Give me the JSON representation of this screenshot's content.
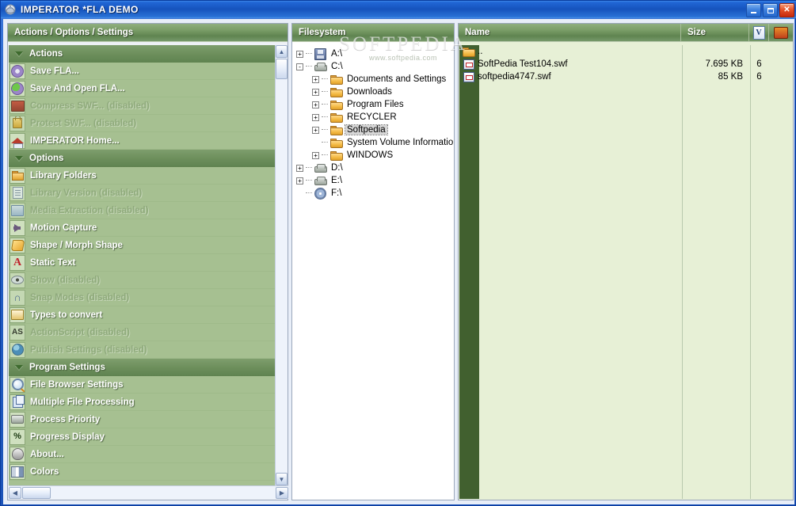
{
  "window": {
    "title": "IMPERATOR *FLA DEMO",
    "icon": "imperator-helmet-icon",
    "buttons": {
      "minimize": "minimize",
      "maximize": "maximize",
      "close": "close"
    }
  },
  "watermark": {
    "big": "SOFTPEDIA",
    "small": "www.softpedia.com"
  },
  "left_panel": {
    "header": "Actions / Options / Settings",
    "rows": [
      {
        "type": "group",
        "label": "Actions",
        "icon": "triangle-down-icon"
      },
      {
        "type": "item",
        "label": "Save FLA...",
        "icon": "gear-purple-icon",
        "disabled": false
      },
      {
        "type": "item",
        "label": "Save And Open FLA...",
        "icon": "gear-green-icon",
        "disabled": false
      },
      {
        "type": "item",
        "label": "Compress SWF... (disabled)",
        "icon": "monitor-red-icon",
        "disabled": true
      },
      {
        "type": "item",
        "label": "Protect SWF... (disabled)",
        "icon": "lock-icon",
        "disabled": true
      },
      {
        "type": "item",
        "label": "IMPERATOR Home...",
        "icon": "house-icon",
        "disabled": false
      },
      {
        "type": "group",
        "label": "Options",
        "icon": "triangle-down-icon"
      },
      {
        "type": "item",
        "label": "Library Folders",
        "icon": "folder-icon",
        "disabled": false
      },
      {
        "type": "item",
        "label": "Library Version (disabled)",
        "icon": "document-icon",
        "disabled": true
      },
      {
        "type": "item",
        "label": "Media Extraction (disabled)",
        "icon": "media-icon",
        "disabled": true
      },
      {
        "type": "item",
        "label": "Motion Capture",
        "icon": "arrow-right-icon",
        "disabled": false
      },
      {
        "type": "item",
        "label": "Shape / Morph Shape",
        "icon": "shape-icon",
        "disabled": false
      },
      {
        "type": "item",
        "label": "Static Text",
        "icon": "letter-a-icon",
        "disabled": false
      },
      {
        "type": "item",
        "label": "Show (disabled)",
        "icon": "eye-icon",
        "disabled": true
      },
      {
        "type": "item",
        "label": "Snap Modes (disabled)",
        "icon": "magnet-icon",
        "disabled": true
      },
      {
        "type": "item",
        "label": "Types to convert",
        "icon": "tray-icon",
        "disabled": false
      },
      {
        "type": "item",
        "label": "ActionScript (disabled)",
        "icon": "actionscript-icon",
        "disabled": true
      },
      {
        "type": "item",
        "label": "Publish Settings (disabled)",
        "icon": "globe-icon",
        "disabled": true
      },
      {
        "type": "group",
        "label": "Program Settings",
        "icon": "triangle-down-icon"
      },
      {
        "type": "item",
        "label": "File Browser Settings",
        "icon": "magnifier-icon",
        "disabled": false
      },
      {
        "type": "item",
        "label": "Multiple File Processing",
        "icon": "copy-icon",
        "disabled": false
      },
      {
        "type": "item",
        "label": "Process Priority",
        "icon": "chip-icon",
        "disabled": false
      },
      {
        "type": "item",
        "label": "Progress Display",
        "icon": "percent-icon",
        "disabled": false
      },
      {
        "type": "item",
        "label": "About...",
        "icon": "helmet-icon",
        "disabled": false
      },
      {
        "type": "item",
        "label": "Colors",
        "icon": "colors-icon",
        "disabled": false
      }
    ],
    "scroll": {
      "up_arrow": "▲",
      "down_arrow": "▼",
      "left_arrow": "◀",
      "right_arrow": "▶"
    }
  },
  "filesystem_panel": {
    "header": "Filesystem",
    "nodes": [
      {
        "label": "A:\\",
        "icon": "floppy-drive-icon",
        "depth": 0,
        "expander": "+",
        "selected": false
      },
      {
        "label": "C:\\",
        "icon": "hard-drive-icon",
        "depth": 0,
        "expander": "-",
        "selected": false
      },
      {
        "label": "Documents and Settings",
        "icon": "folder-icon",
        "depth": 1,
        "expander": "+",
        "selected": false
      },
      {
        "label": "Downloads",
        "icon": "folder-icon",
        "depth": 1,
        "expander": "+",
        "selected": false
      },
      {
        "label": "Program Files",
        "icon": "folder-icon",
        "depth": 1,
        "expander": "+",
        "selected": false
      },
      {
        "label": "RECYCLER",
        "icon": "folder-icon",
        "depth": 1,
        "expander": "+",
        "selected": false
      },
      {
        "label": "Softpedia",
        "icon": "folder-icon",
        "depth": 1,
        "expander": "+",
        "selected": true
      },
      {
        "label": "System Volume Information",
        "icon": "folder-icon",
        "depth": 1,
        "expander": "",
        "selected": false
      },
      {
        "label": "WINDOWS",
        "icon": "folder-icon",
        "depth": 1,
        "expander": "+",
        "selected": false
      },
      {
        "label": "D:\\",
        "icon": "hard-drive-icon",
        "depth": 0,
        "expander": "+",
        "selected": false
      },
      {
        "label": "E:\\",
        "icon": "hard-drive-icon",
        "depth": 0,
        "expander": "+",
        "selected": false
      },
      {
        "label": "F:\\",
        "icon": "cd-drive-icon",
        "depth": 0,
        "expander": "",
        "selected": false
      }
    ]
  },
  "file_panel": {
    "columns": {
      "name": "Name",
      "size": "Size",
      "version_icon": "V",
      "compress_icon": "compress-swf-icon"
    },
    "rows": [
      {
        "name": "..",
        "size": "",
        "version": "",
        "icon": "folder-up-icon"
      },
      {
        "name": "SoftPedia Test104.swf",
        "size": "7.695 KB",
        "version": "6",
        "icon": "swf-file-icon"
      },
      {
        "name": "softpedia4747.swf",
        "size": "85 KB",
        "version": "6",
        "icon": "swf-file-icon"
      }
    ]
  },
  "colors": {
    "title_blue": "#1653bd",
    "panel_header_green": "#6d8f5c",
    "list_green": "#a6c091",
    "file_list_green": "#e7f0d6",
    "stripe_dark_green": "#41602f"
  }
}
